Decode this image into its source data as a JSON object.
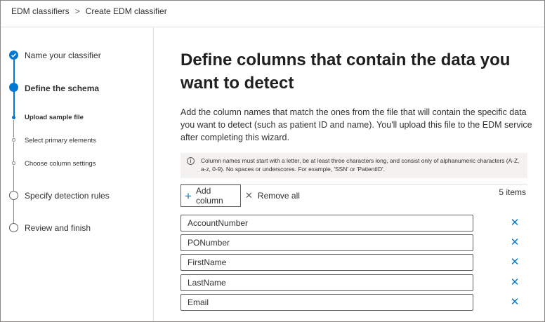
{
  "breadcrumb": {
    "items": [
      "EDM classifiers",
      "Create EDM classifier"
    ],
    "separator": ">"
  },
  "sidebar": {
    "steps": [
      {
        "label": "Name your classifier",
        "state": "completed"
      },
      {
        "label": "Define the schema",
        "state": "current"
      },
      {
        "label": "Upload sample file",
        "state": "current-sub"
      },
      {
        "label": "Select primary elements",
        "state": "pending-sub"
      },
      {
        "label": "Choose column settings",
        "state": "pending-sub"
      },
      {
        "label": "Specify detection rules",
        "state": "pending"
      },
      {
        "label": "Review and finish",
        "state": "pending"
      }
    ]
  },
  "main": {
    "title": "Define columns that contain the data you want to detect",
    "description": "Add the column names that match the ones from the file that will contain the specific data you want to detect (such as patient ID and name). You'll upload this file to the EDM service after completing this wizard.",
    "info": "Column names must start with a letter, be at least three characters long, and consist only of alphanumeric characters (A-Z, a-z, 0-9). No spaces or underscores. For example, 'SSN' or 'PatientID'.",
    "add_column_label": "Add column",
    "remove_all_label": "Remove all",
    "items_count": "5 items",
    "columns": [
      "AccountNumber",
      "PONumber",
      "FirstName",
      "LastName",
      "Email"
    ]
  },
  "colors": {
    "accent": "#0078d4",
    "text": "#323130",
    "border": "#605e5c",
    "info_bg": "#f3f2f1"
  },
  "icons": {
    "check": "checkmark-icon",
    "add": "plus-icon",
    "remove": "close-icon",
    "info": "info-icon"
  }
}
